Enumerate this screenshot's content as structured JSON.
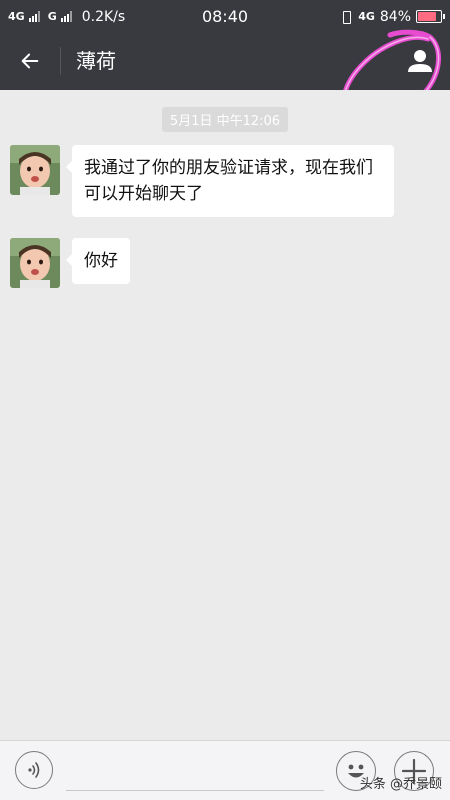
{
  "status_bar": {
    "network1": "4G",
    "network2": "G",
    "speed": "0.2K/s",
    "time": "08:40",
    "network3": "4G",
    "battery_pct": "84%",
    "battery_level": 0.84
  },
  "header": {
    "title": "薄荷"
  },
  "chat": {
    "timestamp": "5月1日 中午12:06",
    "messages": [
      {
        "text": "我通过了你的朋友验证请求，现在我们可以开始聊天了"
      },
      {
        "text": "你好"
      }
    ]
  },
  "input": {
    "placeholder": ""
  },
  "watermark": "头条 @乔景颐",
  "colors": {
    "topbar": "#393a3f",
    "chat_bg": "#ebebeb",
    "highlight": "#e64bd0"
  }
}
